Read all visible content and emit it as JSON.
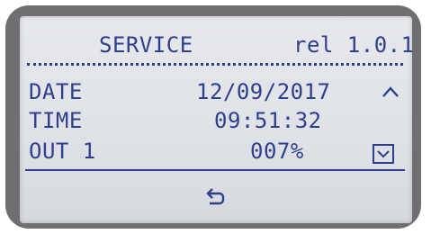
{
  "header": {
    "title": "SERVICE",
    "release": "rel 1.0.1"
  },
  "rows": [
    {
      "label": "DATE",
      "value": "12/09/2017",
      "icon": "chevron-up-icon"
    },
    {
      "label": "TIME",
      "value": "09:51:32"
    },
    {
      "label": "OUT 1",
      "value": "007%",
      "icon": "chevron-down-icon"
    }
  ],
  "footer": {
    "icon": "back-icon"
  },
  "colors": {
    "lcd_text": "#2f3f8e",
    "lcd_background": "#e3e5e9",
    "bezel": "#6f6f71"
  }
}
